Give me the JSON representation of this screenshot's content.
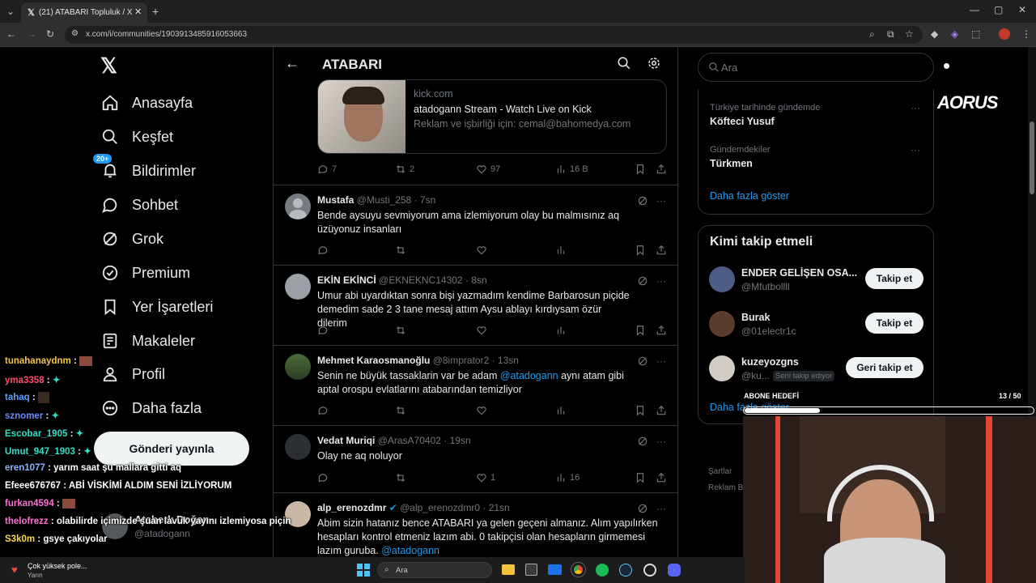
{
  "browser": {
    "tab_title": "(21) ATABARI Topluluk / X",
    "url": "x.com/i/communities/1903913485916053663"
  },
  "nav": {
    "items": [
      {
        "key": "home",
        "label": "Anasayfa"
      },
      {
        "key": "explore",
        "label": "Keşfet"
      },
      {
        "key": "notifications",
        "label": "Bildirimler",
        "badge": "20+"
      },
      {
        "key": "chat",
        "label": "Sohbet"
      },
      {
        "key": "grok",
        "label": "Grok"
      },
      {
        "key": "premium",
        "label": "Premium"
      },
      {
        "key": "bookmarks",
        "label": "Yer İşaretleri"
      },
      {
        "key": "articles",
        "label": "Makaleler"
      },
      {
        "key": "profile",
        "label": "Profil"
      },
      {
        "key": "more",
        "label": "Daha fazla"
      }
    ],
    "post_button": "Gönderi yayınla",
    "account_name": "Ataberk Doğan",
    "account_handle": "@atadogann"
  },
  "header": {
    "title": "ATABARI"
  },
  "card": {
    "domain": "kick.com",
    "title": "atadogann Stream - Watch Live on Kick",
    "desc": "Reklam ve işbirliği için: cemal@bahomedya.com",
    "replies": "7",
    "reposts": "2",
    "likes": "97",
    "views": "16 B"
  },
  "posts": [
    {
      "name": "Mustafa",
      "handle": "@Musti_258",
      "time": "7sn",
      "text": "Bende aysuyu sevmiyorum ama izlemiyorum olay bu malmısınız aq üzüyonuz insanları",
      "replies": "",
      "reposts": "",
      "likes": "",
      "views": ""
    },
    {
      "name": "EKİN EKİNCİ",
      "handle": "@EKNEKNC14302",
      "time": "8sn",
      "text": "Umur abi uyardıktan sonra bişi yazmadım kendime Barbarosun piçide demedim sade 2 3 tane mesaj attım Aysu ablayı kırdıysam özür dilerim",
      "replies": "",
      "reposts": "",
      "likes": "",
      "views": ""
    },
    {
      "name": "Mehmet Karaosmanoğlu",
      "handle": "@8imprator2",
      "time": "13sn",
      "text_before": "Senin ne büyük tassaklarin var be adam ",
      "mention": "@atadogann",
      "text_after": " aynı atam gibi aptal orospu evlatlarını atabarından temizliyor",
      "replies": "",
      "reposts": "",
      "likes": "",
      "views": ""
    },
    {
      "name": "Vedat Muriqi",
      "handle": "@ArasA70402",
      "time": "19sn",
      "text": "Olay ne aq noluyor",
      "replies": "",
      "reposts": "",
      "likes": "1",
      "views": "16"
    },
    {
      "name": "alp_erenozdmr",
      "handle": "@alp_erenozdmr0",
      "time": "21sn",
      "text_before": "Abim sizin hatanız bence ATABARI ya gelen geçeni almanız. Alım yapılırken hesapları kontrol etmeniz lazım abi. 0 takipçisi olan hesapların girmemesi lazım guruba. ",
      "mention": "@atadogann",
      "text_after": ""
    }
  ],
  "search": {
    "placeholder": "Ara"
  },
  "trends": {
    "items": [
      {
        "context": "Türkiye tarihinde gündemde",
        "title": "Köfteci Yusuf"
      },
      {
        "context": "Gündemdekiler",
        "title": "Türkmen"
      }
    ],
    "show_more": "Daha fazla göster"
  },
  "who_to_follow": {
    "title": "Kimi takip etmeli",
    "users": [
      {
        "name": "ENDER GELİŞEN OSA...",
        "handle": "@Mfutbollll",
        "button": "Takip et",
        "note": ""
      },
      {
        "name": "Burak",
        "handle": "@01electr1c",
        "button": "Takip et",
        "note": ""
      },
      {
        "name": "kuzeyozgns",
        "handle": "@ku...",
        "button": "Geri takip et",
        "note": "Seni takip ediyor"
      }
    ],
    "show_more": "Daha fazla göster"
  },
  "footer": {
    "terms": "Şartlar",
    "ads": "Reklam Bil"
  },
  "overlay": {
    "brand": "AORUS",
    "sub_goal_label": "ABONE HEDEFİ",
    "sub_goal_count": "13 / 50",
    "sub_goal_progress": 0.26,
    "chat": [
      {
        "user": "tunahanaydnm",
        "msg": "",
        "color": "#f5c542"
      },
      {
        "user": "yma3358",
        "msg": "",
        "color": "#ff4b6e"
      },
      {
        "user": "tahaq",
        "msg": "",
        "color": "#5aa0ff"
      },
      {
        "user": "sznomer",
        "msg": "",
        "color": "#6b8cff"
      },
      {
        "user": "Escobar_1905",
        "msg": "",
        "color": "#2ee0c8"
      },
      {
        "user": "Umut_947_1903",
        "msg": "",
        "color": "#2ee0c8"
      },
      {
        "user": "eren1077",
        "msg": "yarım saat şu mallara gitti aq",
        "color": "#8ab4ff"
      },
      {
        "user": "Efeee676767",
        "msg": "ABİ VİSKİMİ ALDIM SENİ İZLİYORUM",
        "color": "#ffffff"
      },
      {
        "user": "furkan4594",
        "msg": "",
        "color": "#ff6fd8"
      },
      {
        "user": "thelofrezz",
        "msg": "olabilirde içimizde şuan lavuk yayını izlemiyosa piçin",
        "color": "#ff6fd8"
      },
      {
        "user": "S3k0m",
        "msg": "gsye çakıyolar",
        "color": "#ffd84a"
      }
    ]
  },
  "taskbar": {
    "notification_title": "Çok yüksek pole...",
    "notification_sub": "Yarın",
    "search_placeholder": "Ara"
  },
  "colors": {
    "accent": "#1d9bf0",
    "background": "#000000",
    "border": "#2f3336",
    "muted": "#71767b"
  }
}
